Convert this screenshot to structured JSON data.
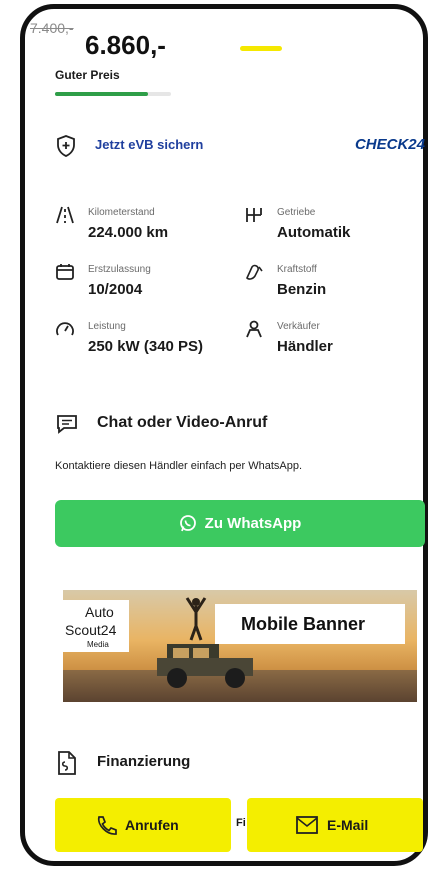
{
  "price": {
    "old": "7.400,-",
    "current": "6.860,-",
    "rating_label": "Guter Preis",
    "rating_fraction": 0.8
  },
  "insurance": {
    "link": "Jetzt eVB sichern",
    "partner": "CHECK24"
  },
  "specs": [
    {
      "icon": "mileage-icon",
      "label": "Kilometerstand",
      "value": "224.000 km"
    },
    {
      "icon": "gearbox-icon",
      "label": "Getriebe",
      "value": "Automatik"
    },
    {
      "icon": "calendar-icon",
      "label": "Erstzulassung",
      "value": "10/2004"
    },
    {
      "icon": "fuel-pump-icon",
      "label": "Kraftstoff",
      "value": "Benzin"
    },
    {
      "icon": "speedometer-icon",
      "label": "Leistung",
      "value": "250 kW (340 PS)"
    },
    {
      "icon": "person-icon",
      "label": "Verkäufer",
      "value": "Händler"
    }
  ],
  "chat": {
    "title": "Chat oder Video-Anruf",
    "description": "Kontaktiere diesen Händler einfach per WhatsApp.",
    "button": "Zu WhatsApp"
  },
  "banner": {
    "logo_line1": "Auto",
    "logo_line2": "Scout24",
    "logo_line3": "Media",
    "text": "Mobile Banner"
  },
  "finance": {
    "title": "Finanzierung",
    "cut_text": "Fi"
  },
  "actions": {
    "call": "Anrufen",
    "mail": "E-Mail"
  },
  "colors": {
    "whatsapp_green": "#3cc960",
    "action_yellow": "#f4ee00",
    "rating_green": "#2e9e48",
    "link_blue": "#1f3f9e"
  }
}
